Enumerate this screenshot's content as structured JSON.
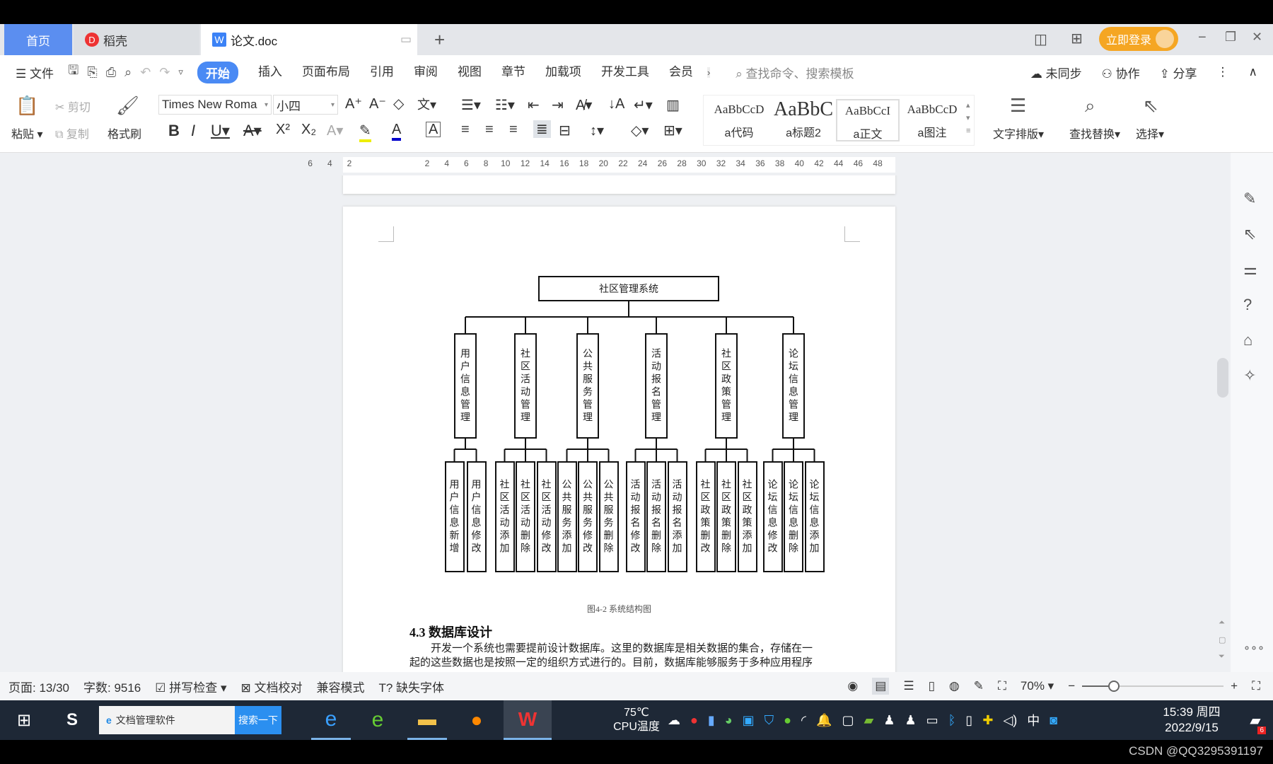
{
  "tabs": {
    "home": "首页",
    "daoke": "稻壳",
    "doc": "论文.doc",
    "new_tab": "+"
  },
  "titlebar": {
    "login": "立即登录",
    "minimize": "−",
    "restore": "❐",
    "close": "✕"
  },
  "menu": {
    "file": "文件",
    "items": [
      "开始",
      "插入",
      "页面布局",
      "引用",
      "审阅",
      "视图",
      "章节",
      "加载项",
      "开发工具",
      "会员"
    ],
    "active_index": 0,
    "search_placeholder": "查找命令、搜索模板",
    "sync": "未同步",
    "collab": "协作",
    "share": "分享"
  },
  "ribbon": {
    "paste": "粘贴",
    "cut": "剪切",
    "copy": "复制",
    "format_painter": "格式刷",
    "font_name": "Times New Roma",
    "font_size": "小四",
    "styles": [
      {
        "preview": "AaBbCcD",
        "label": "a代码"
      },
      {
        "preview": "AaBbC",
        "label": "a标题2"
      },
      {
        "preview": "AaBbCcI",
        "label": "a正文"
      },
      {
        "preview": "AaBbCcD",
        "label": "a图注"
      }
    ],
    "active_style_index": 2,
    "text_layout": "文字排版",
    "find_replace": "查找替换",
    "select": "选择"
  },
  "ruler": {
    "left": [
      "6",
      "4",
      "2"
    ],
    "right": [
      "2",
      "4",
      "6",
      "8",
      "10",
      "12",
      "14",
      "16",
      "18",
      "20",
      "22",
      "24",
      "26",
      "28",
      "30",
      "32",
      "34",
      "36",
      "38",
      "40",
      "42",
      "44",
      "46",
      "48"
    ]
  },
  "diagram": {
    "root": "社区管理系统",
    "modules": [
      {
        "label": "用户信息管理",
        "children": [
          "用户信息新增",
          "用户信息修改"
        ]
      },
      {
        "label": "社区活动管理",
        "children": [
          "社区活动添加",
          "社区活动删除",
          "社区活动修改"
        ]
      },
      {
        "label": "公共服务管理",
        "children": [
          "公共服务添加",
          "公共服务修改",
          "公共服务删除"
        ]
      },
      {
        "label": "活动报名管理",
        "children": [
          "活动报名修改",
          "活动报名删除",
          "活动报名添加"
        ]
      },
      {
        "label": "社区政策管理",
        "children": [
          "社区政策删改",
          "社区政策删除",
          "社区政策添加"
        ]
      },
      {
        "label": "论坛信息管理",
        "children": [
          "论坛信息修改",
          "论坛信息删除",
          "论坛信息添加"
        ]
      }
    ]
  },
  "document": {
    "caption": "图4-2  系统结构图",
    "heading": "4.3  数据库设计",
    "para1": "开发一个系统也需要提前设计数据库。这里的数据库是相关数据的集合，存储在一",
    "para2": "起的这些数据也是按照一定的组织方式进行的。目前，数据库能够服务于多种应用程序"
  },
  "status": {
    "page": "页面: 13/30",
    "words": "字数: 9516",
    "spell": "拼写检查",
    "proof": "文档校对",
    "compat": "兼容模式",
    "missing_font": "缺失字体",
    "zoom": "70%",
    "zoom_percent": 70
  },
  "taskbar": {
    "search_text": "文档管理软件",
    "search_button": "搜索一下",
    "temp": "75℃",
    "temp_label": "CPU温度",
    "ime": "中",
    "time": "15:39 周四",
    "date": "2022/9/15",
    "notif_count": "6"
  },
  "watermark": "CSDN @QQ3295391197",
  "colors": {
    "accent": "#4a8af4",
    "home_tab": "#5b8ef0",
    "login": "#f5a623",
    "taskbar": "#1e2836"
  }
}
